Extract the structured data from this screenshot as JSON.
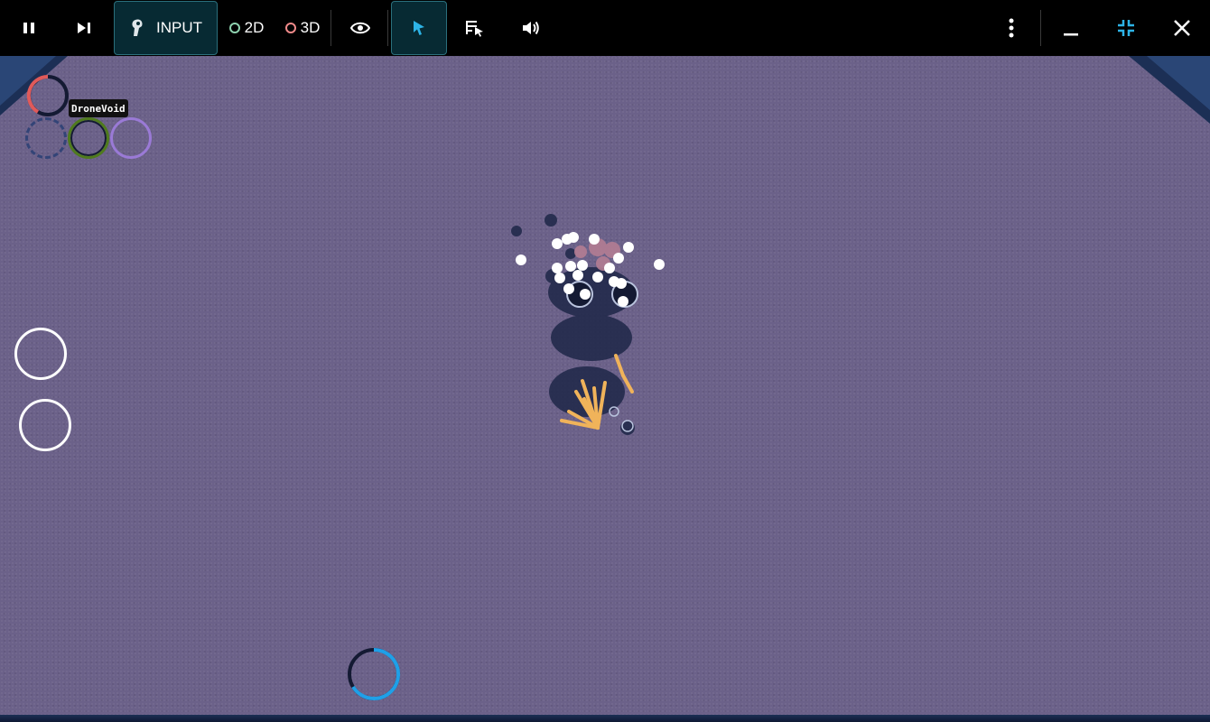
{
  "toolbar": {
    "pause_icon": "pause-icon",
    "step_icon": "step-forward-icon",
    "input_label": "INPUT",
    "input_icon": "joystick-icon",
    "mode_2d_label": "2D",
    "mode_3d_label": "3D",
    "visibility_icon": "eye-icon",
    "pointer_icon": "cursor-arrow-icon",
    "inspector_icon": "list-select-icon",
    "sound_icon": "volume-icon",
    "more_icon": "more-vertical-icon",
    "minimize_icon": "minimize-icon",
    "collapse_icon": "collapse-icon",
    "close_icon": "close-icon",
    "colors": {
      "accent": "#2db3e6",
      "ring_2d": "#8fd3b0",
      "ring_3d": "#f08a8a"
    }
  },
  "hud": {
    "player_name": "DroneVoid",
    "health_ring_color": "#e05a5a",
    "ability_ring_colors": [
      "#3a4a7a",
      "#4f7a1e",
      "#9a7ad6"
    ],
    "cooldown_fraction": 0.6,
    "cooldown_color": "#1fa0e8"
  },
  "colors": {
    "floor": "#6b6189",
    "enemy_dark": "#1e2748",
    "projectile": "#ffffff",
    "spark": "#f0b35a"
  }
}
